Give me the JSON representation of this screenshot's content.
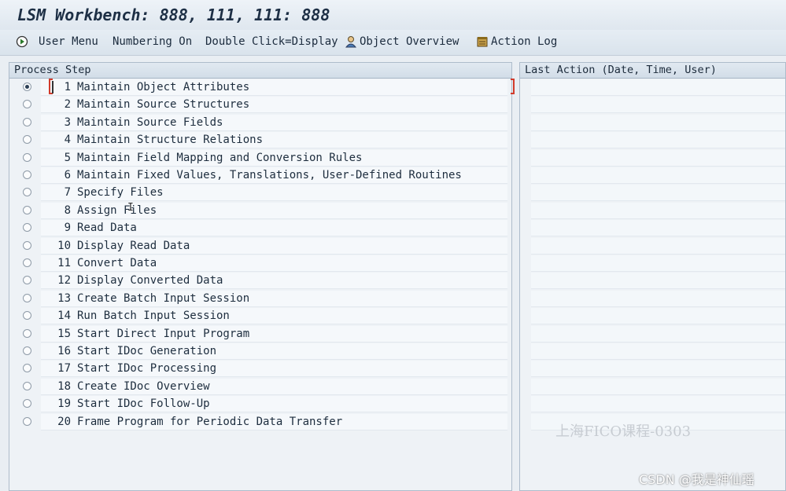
{
  "window": {
    "title": "LSM Workbench: 888, 111, 111: 888"
  },
  "toolbar": {
    "user_menu": "User Menu",
    "numbering": "Numbering On",
    "double_click": "Double Click=Display",
    "object_overview": "Object Overview",
    "action_log": "Action Log"
  },
  "left_panel": {
    "header": "Process Step",
    "selected_index": 0,
    "steps": [
      {
        "num": "1",
        "label": "Maintain Object Attributes"
      },
      {
        "num": "2",
        "label": "Maintain Source Structures"
      },
      {
        "num": "3",
        "label": "Maintain Source Fields"
      },
      {
        "num": "4",
        "label": "Maintain Structure Relations"
      },
      {
        "num": "5",
        "label": "Maintain Field Mapping and Conversion Rules"
      },
      {
        "num": "6",
        "label": "Maintain Fixed Values, Translations, User-Defined Routines"
      },
      {
        "num": "7",
        "label": "Specify Files"
      },
      {
        "num": "8",
        "label": "Assign Files"
      },
      {
        "num": "9",
        "label": "Read Data"
      },
      {
        "num": "10",
        "label": "Display Read Data"
      },
      {
        "num": "11",
        "label": "Convert Data"
      },
      {
        "num": "12",
        "label": "Display Converted Data"
      },
      {
        "num": "13",
        "label": "Create Batch Input Session"
      },
      {
        "num": "14",
        "label": "Run Batch Input Session"
      },
      {
        "num": "15",
        "label": "Start Direct Input Program"
      },
      {
        "num": "16",
        "label": "Start IDoc Generation"
      },
      {
        "num": "17",
        "label": "Start IDoc Processing"
      },
      {
        "num": "18",
        "label": "Create IDoc Overview"
      },
      {
        "num": "19",
        "label": "Start IDoc Follow-Up"
      },
      {
        "num": "20",
        "label": "Frame Program for Periodic Data Transfer"
      }
    ]
  },
  "right_panel": {
    "header": "Last Action (Date, Time, User)"
  },
  "watermarks": {
    "center": "上海FICO课程-0303",
    "corner": "CSDN @我是神仙瑶"
  },
  "icons": {
    "user_menu": "execute-icon",
    "object_overview": "object-overview-icon",
    "action_log": "action-log-icon"
  }
}
